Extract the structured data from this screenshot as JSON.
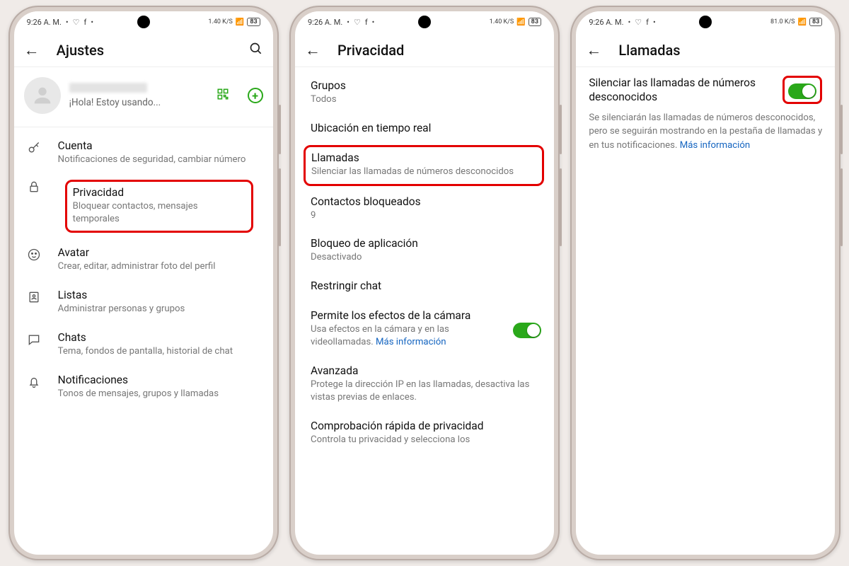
{
  "statusbar": {
    "time": "9:26 A. M.",
    "net": "1.40 K/S",
    "net3": "81.0 K/S",
    "battery": "83",
    "battery3": "83"
  },
  "screen1": {
    "title": "Ajustes",
    "profile_status": "¡Hola! Estoy usando...",
    "items": {
      "account": {
        "title": "Cuenta",
        "sub": "Notificaciones de seguridad, cambiar número"
      },
      "privacy": {
        "title": "Privacidad",
        "sub": "Bloquear contactos, mensajes temporales"
      },
      "avatar": {
        "title": "Avatar",
        "sub": "Crear, editar, administrar foto del perfil"
      },
      "lists": {
        "title": "Listas",
        "sub": "Administrar personas y grupos"
      },
      "chats": {
        "title": "Chats",
        "sub": "Tema, fondos de pantalla, historial de chat"
      },
      "notifications": {
        "title": "Notificaciones",
        "sub": "Tonos de mensajes, grupos y llamadas"
      }
    }
  },
  "screen2": {
    "title": "Privacidad",
    "items": {
      "groups": {
        "title": "Grupos",
        "sub": "Todos"
      },
      "location": {
        "title": "Ubicación en tiempo real"
      },
      "calls": {
        "title": "Llamadas",
        "sub": "Silenciar las llamadas de números desconocidos"
      },
      "blocked": {
        "title": "Contactos bloqueados",
        "sub": "9"
      },
      "applock": {
        "title": "Bloqueo de aplicación",
        "sub": "Desactivado"
      },
      "restrict": {
        "title": "Restringir chat"
      },
      "camera": {
        "title": "Permite los efectos de la cámara",
        "sub": "Usa efectos en la cámara y en las videollamadas. ",
        "link": "Más información"
      },
      "advanced": {
        "title": "Avanzada",
        "sub": "Protege la dirección IP en las llamadas, desactiva las vistas previas de enlaces."
      },
      "check": {
        "title": "Comprobación rápida de privacidad",
        "sub": "Controla tu privacidad y selecciona los"
      }
    }
  },
  "screen3": {
    "title": "Llamadas",
    "option_title": "Silenciar las llamadas de números desconocidos",
    "option_desc": "Se silenciarán las llamadas de números desconocidos, pero se seguirán mostrando en la pestaña de llamadas y en tus notificaciones. ",
    "option_link": "Más información"
  }
}
